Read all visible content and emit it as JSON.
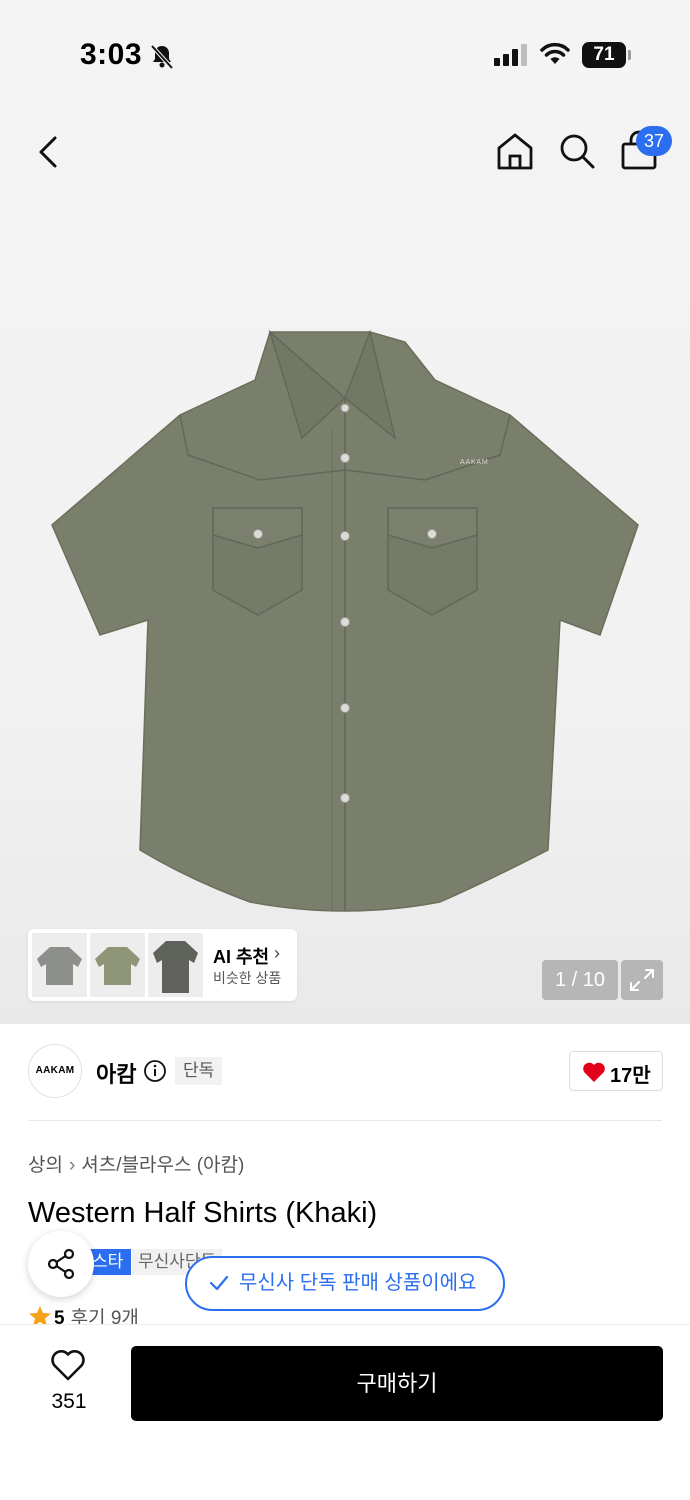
{
  "status_bar": {
    "time": "3:03",
    "battery": "71"
  },
  "nav": {
    "cart_count": "37"
  },
  "gallery": {
    "ai_title": "AI 추천",
    "ai_subtitle": "비슷한 상품",
    "page_indicator": "1 / 10",
    "product_color": "#7a7f6b"
  },
  "brand": {
    "logo_text": "AAKAM",
    "name": "아캄",
    "tag": "단독",
    "likes": "17만"
  },
  "product": {
    "breadcrumb": [
      "상의",
      "셔츠/블라우스 (아캄)"
    ],
    "title": "Western Half Shirts (Khaki)",
    "tag_blue": "스타",
    "tag_gray": "무신사단독",
    "rating": "5",
    "reviews": "후기 9개"
  },
  "toast": {
    "text": "무신사 단독 판매 상품이에요"
  },
  "bottom": {
    "wish_count": "351",
    "buy_label": "구매하기"
  },
  "colors": {
    "accent": "#2b6ef0",
    "heart": "#e3001b",
    "star": "#f7a21b"
  }
}
